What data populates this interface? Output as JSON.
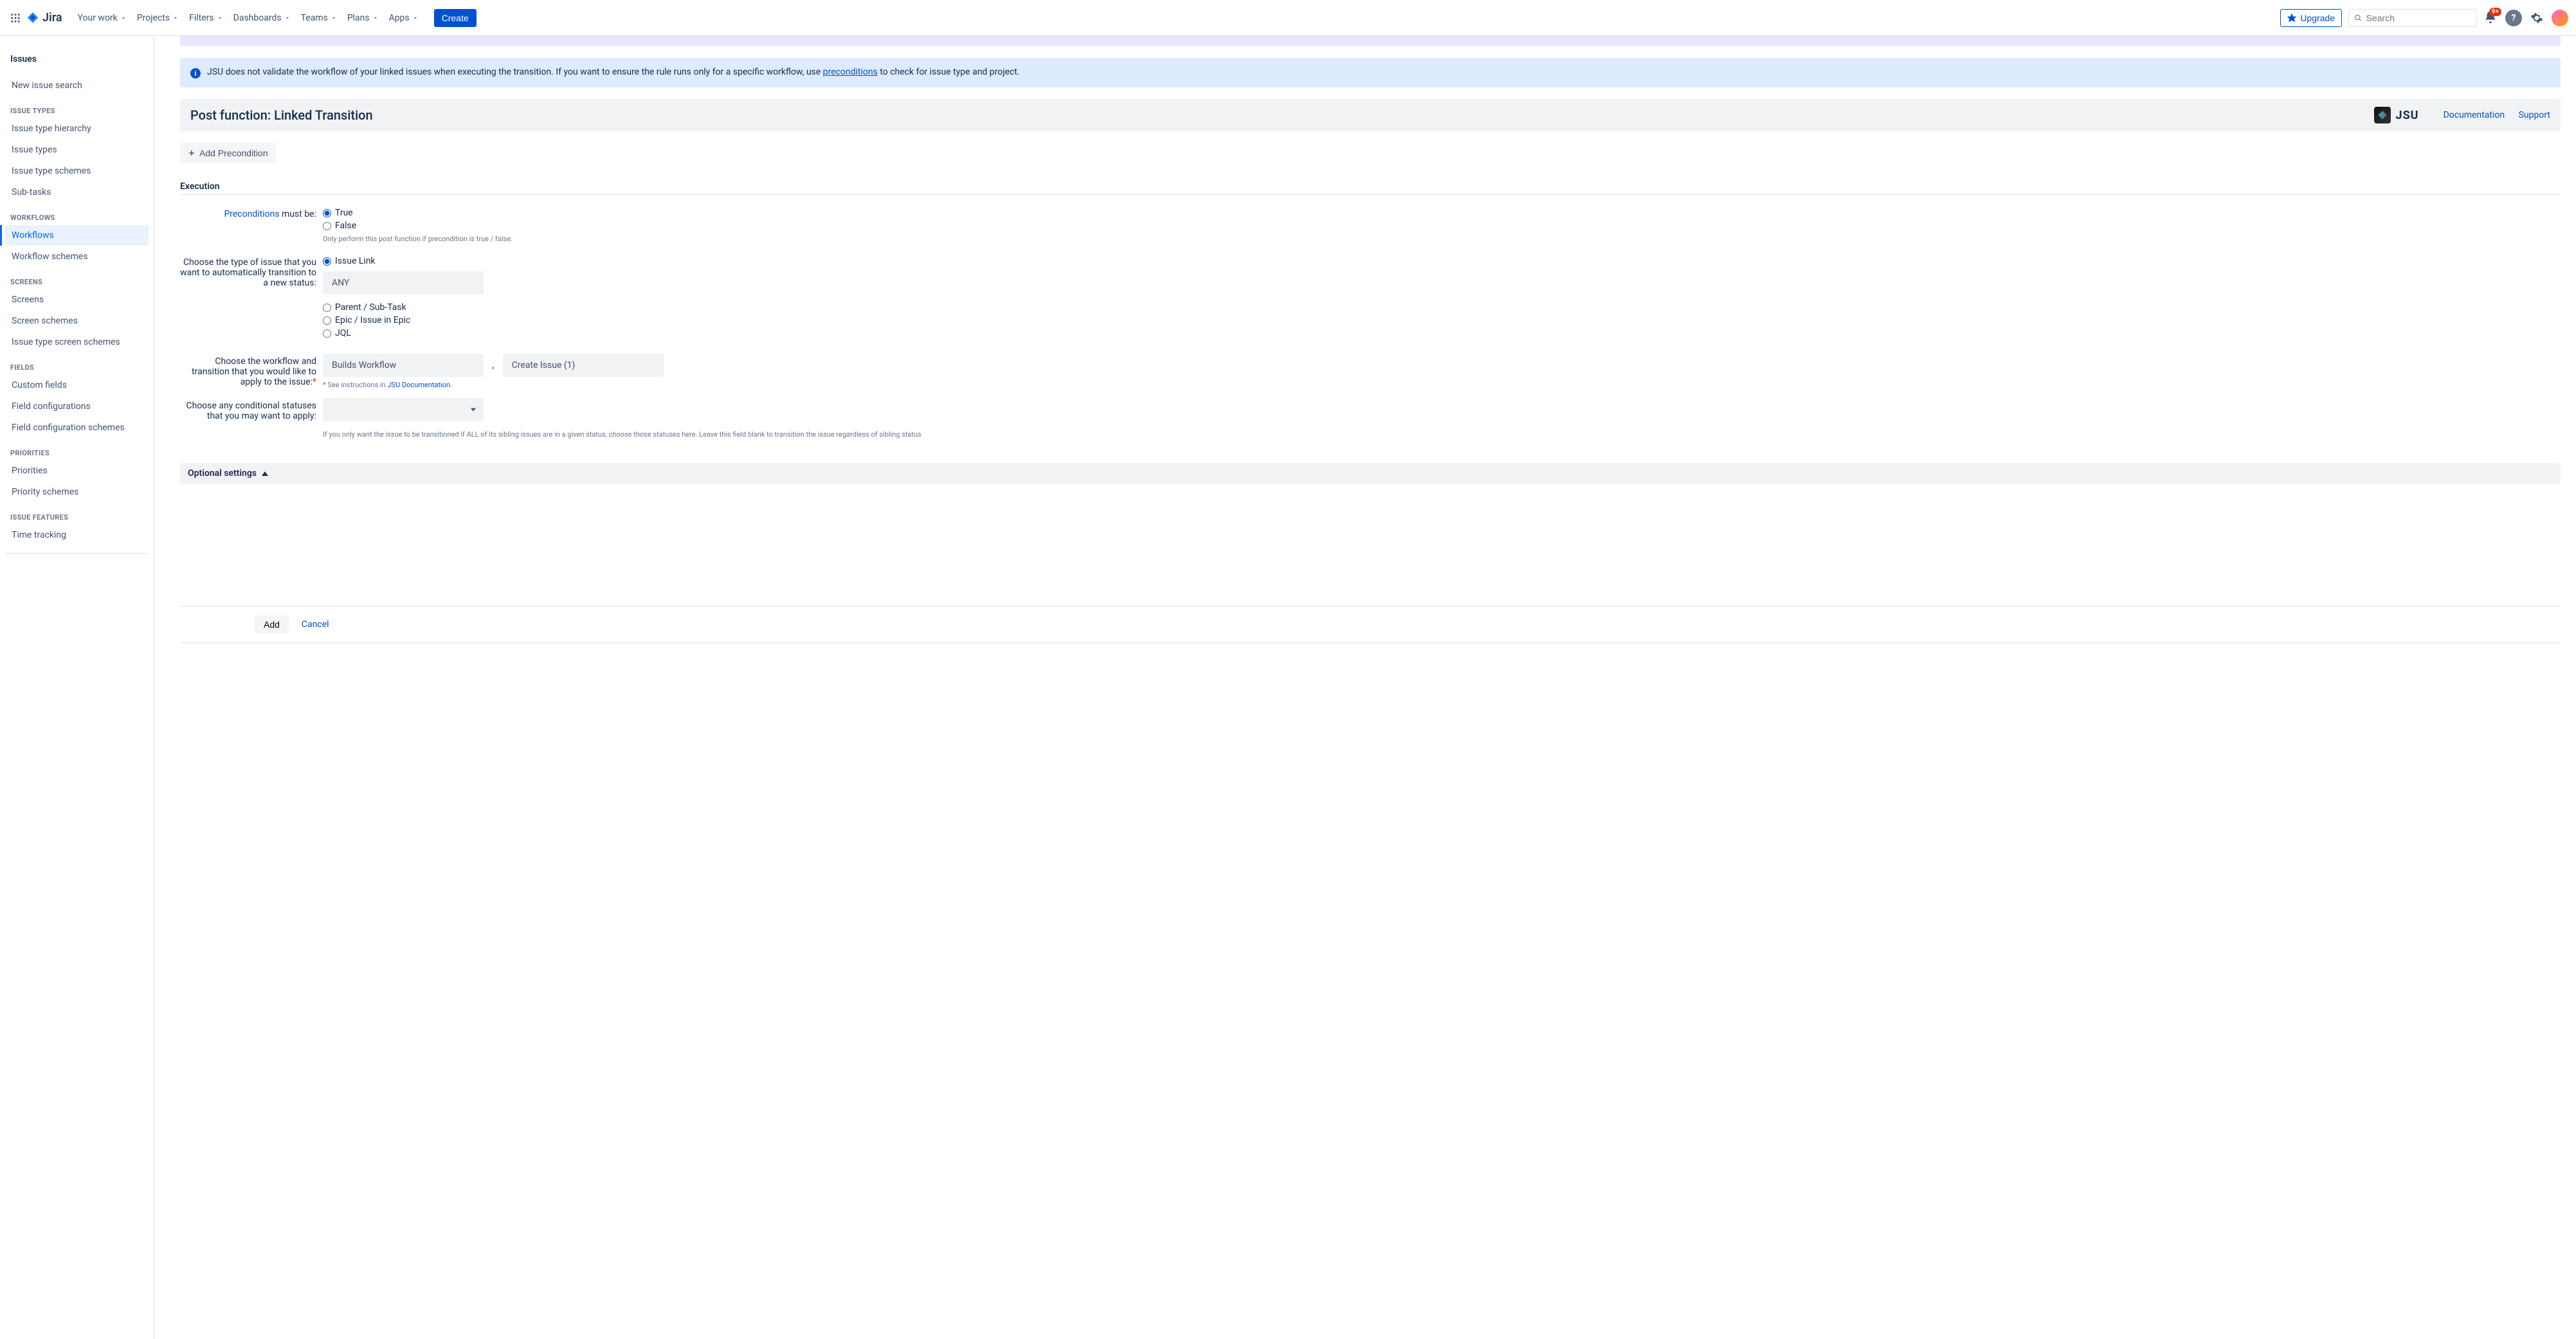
{
  "topnav": {
    "logo_text": "Jira",
    "items": [
      "Your work",
      "Projects",
      "Filters",
      "Dashboards",
      "Teams",
      "Plans",
      "Apps"
    ],
    "create": "Create",
    "upgrade": "Upgrade",
    "search_placeholder": "Search",
    "notif_count": "9+"
  },
  "sidebar": {
    "title": "Issues",
    "top_item": "New issue search",
    "sections": [
      {
        "label": "ISSUE TYPES",
        "items": [
          "Issue type hierarchy",
          "Issue types",
          "Issue type schemes",
          "Sub-tasks"
        ]
      },
      {
        "label": "WORKFLOWS",
        "items": [
          "Workflows",
          "Workflow schemes"
        ],
        "active_index": 0
      },
      {
        "label": "SCREENS",
        "items": [
          "Screens",
          "Screen schemes",
          "Issue type screen schemes"
        ]
      },
      {
        "label": "FIELDS",
        "items": [
          "Custom fields",
          "Field configurations",
          "Field configuration schemes"
        ]
      },
      {
        "label": "PRIORITIES",
        "items": [
          "Priorities",
          "Priority schemes"
        ]
      },
      {
        "label": "ISSUE FEATURES",
        "items": [
          "Time tracking"
        ]
      }
    ]
  },
  "banner": {
    "text_pre": "JSU does not validate the workflow of your linked issues when executing the transition. If you want to ensure the rule runs only for a specific workflow, use ",
    "link": "preconditions",
    "text_post": " to check for issue type and project."
  },
  "header": {
    "title": "Post function: Linked Transition",
    "brand": "JSU",
    "doc_link": "Documentation",
    "support_link": "Support"
  },
  "add_precondition": "Add Precondition",
  "execution": {
    "section": "Execution",
    "preconditions_link": "Preconditions",
    "preconditions_suffix": " must be:",
    "opt_true": "True",
    "opt_false": "False",
    "pre_help": "Only perform this post function if precondition is true / false.",
    "type_label": "Choose the type of issue that you want to automatically transition to a new status:",
    "type_options": [
      "Issue Link",
      "Parent / Sub-Task",
      "Epic / Issue in Epic",
      "JQL"
    ],
    "link_type_value": "ANY",
    "workflow_label": "Choose the workflow and transition that you would like to apply to the issue:",
    "workflow_value": "Builds Workflow",
    "transition_value": "Create Issue (1)",
    "workflow_sep": ",",
    "workflow_note_pre": "* See instructions in ",
    "workflow_note_link": "JSU Documentation.",
    "cond_label": "Choose any conditional statuses that you may want to apply:",
    "cond_help": "If you only want the issue to be transitioned if ALL of its sibling issues are in a given status, choose those statuses here. Leave this field blank to transition the issue regardless of sibling status"
  },
  "optional": {
    "title": "Optional settings"
  },
  "footer": {
    "add": "Add",
    "cancel": "Cancel"
  }
}
